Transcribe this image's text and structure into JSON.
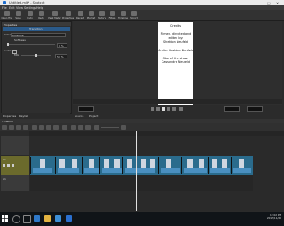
{
  "window": {
    "title": "Untitled.mlt* - Shotcut"
  },
  "menu": [
    "File",
    "Edit",
    "View",
    "Settings",
    "Help"
  ],
  "toolbar": [
    "Open File",
    "Save",
    "Undo",
    "Redo",
    "Peak Meter",
    "Properties",
    "Recent",
    "Playlist",
    "History",
    "Filters",
    "Timeline",
    "Export"
  ],
  "properties": {
    "header": "Properties",
    "transition_label": "Transition",
    "video_label": "Video",
    "video_value": "Dissolve",
    "softness_label": "Softness",
    "softness_value": "0 %",
    "audio_label": "Audio",
    "mix_label": "Mix",
    "mix_value": "50 %"
  },
  "preview": {
    "lines": [
      "Credits",
      "",
      "Filmed, directed and",
      "edited by:",
      "Sheldon Neufeld",
      "",
      "Audio: Sheldon Neufeld",
      "",
      "Star of the show:",
      "Cassandra Neufeld"
    ]
  },
  "bottom_tabs": {
    "left": [
      "Properties",
      "Playlist"
    ],
    "right": [
      "Source",
      "Project"
    ]
  },
  "timeline": {
    "header": "Timeline",
    "tracks": [
      "V1",
      "A1"
    ]
  },
  "clock": {
    "time": "12:02 PM",
    "date": "2017/11/20"
  },
  "colors": {
    "accent": "#2a5a8a",
    "clip": "#2a6b8c",
    "track_selected": "#6b6a2c"
  }
}
